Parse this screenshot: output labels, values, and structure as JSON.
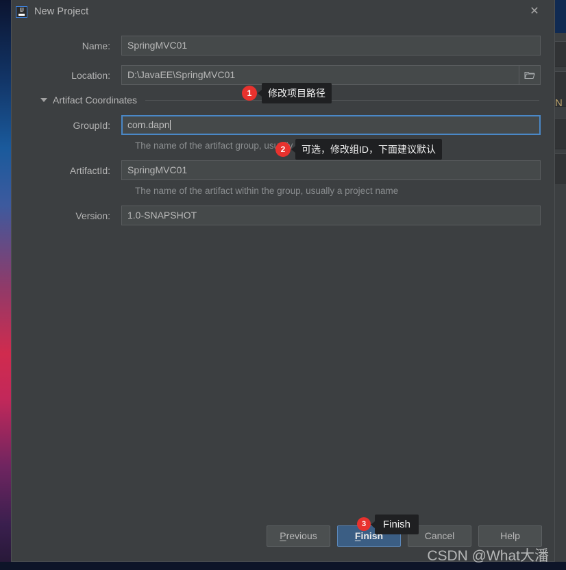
{
  "window": {
    "title": "New Project",
    "app_icon": "intellij-idea-icon",
    "close_icon": "close-icon"
  },
  "form": {
    "name": {
      "label": "Name:",
      "value": "SpringMVC01",
      "placeholder": ""
    },
    "location": {
      "label": "Location:",
      "value": "D:\\JavaEE\\SpringMVC01",
      "placeholder": "",
      "browse_icon": "folder-icon"
    },
    "section": {
      "label": "Artifact Coordinates",
      "expanded": true,
      "arrow_icon": "chevron-down-icon"
    },
    "group_id": {
      "label": "GroupId:",
      "value": "com.dapn",
      "placeholder": "",
      "hint": "The name of the artifact group, usually a company domain",
      "focused": true
    },
    "artifact_id": {
      "label": "ArtifactId:",
      "value": "SpringMVC01",
      "placeholder": "",
      "hint": "The name of the artifact within the group, usually a project name"
    },
    "version": {
      "label": "Version:",
      "value": "1.0-SNAPSHOT",
      "placeholder": ""
    }
  },
  "callouts": [
    {
      "number": "1",
      "text": "修改项目路径"
    },
    {
      "number": "2",
      "text": "可选，修改组ID，下面建议默认"
    },
    {
      "number": "3",
      "text": "Finish"
    }
  ],
  "footer": {
    "previous": "Previous",
    "previous_mnemonic": "P",
    "finish": "Finish",
    "finish_mnemonic": "F",
    "cancel": "Cancel",
    "help": "Help"
  },
  "watermark": "CSDN @What大潘",
  "background": {
    "ide_letter": "N"
  },
  "colors": {
    "dialog_bg": "#3c3f41",
    "field_bg": "#45494a",
    "accent_blue": "#4a88c7",
    "primary_button": "#3b5e84",
    "badge_red": "#e8322e",
    "tooltip_bg": "#1f2022",
    "text": "#b4b4b4",
    "hint_text": "#8a8d8f"
  }
}
